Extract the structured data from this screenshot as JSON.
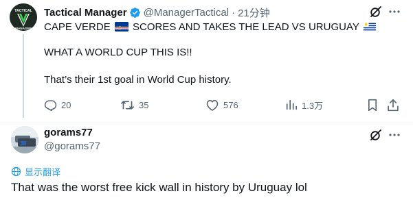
{
  "tweet": {
    "author_name": "Tactical Manager",
    "author_handle": "@ManagerTactical",
    "separator": "·",
    "time": "21分钟",
    "avatar_text_top": "TACTICAL",
    "avatar_text_bottom": "MANAGER",
    "line1_a": "CAPE VERDE",
    "line1_b": "SCORES AND TAKES THE LEAD VS URUGUAY",
    "line2": "WHAT A WORLD CUP THIS IS!!",
    "line3": "That’s their 1st goal in World Cup history.",
    "stats": {
      "replies": "20",
      "retweets": "35",
      "likes": "576",
      "views": "1.3万"
    }
  },
  "reply": {
    "author_name": "gorams77",
    "author_handle": "@gorams77",
    "translate_label": "显示翻译",
    "text": "That was the worst free kick wall in history by Uruguay lol"
  },
  "icons": {
    "verified": "verified-badge-icon",
    "grok": "grok-icon",
    "more": "more-dots-icon",
    "reply": "reply-icon",
    "retweet": "retweet-icon",
    "like": "like-icon",
    "views": "views-icon",
    "bookmark": "bookmark-icon",
    "share": "share-icon",
    "translate": "globe-icon",
    "flag_cv": "cape-verde-flag-icon",
    "flag_uy": "uruguay-flag-icon"
  },
  "colors": {
    "text": "#0f1419",
    "secondary": "#536471",
    "accent": "#1d9bf0"
  }
}
